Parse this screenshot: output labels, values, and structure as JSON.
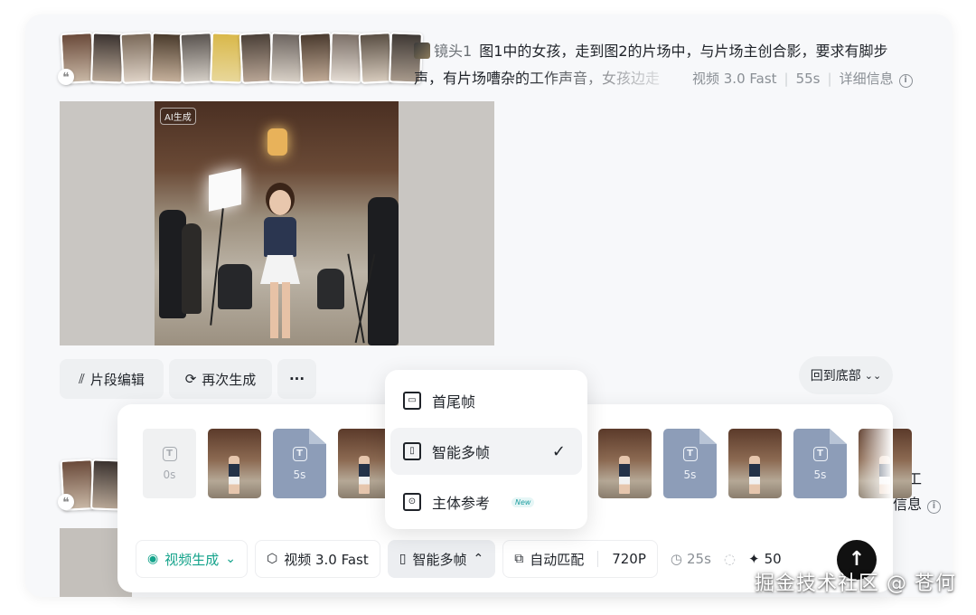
{
  "record1": {
    "shot_label": "镜头1",
    "prompt_line1": "图1中的女孩，走到图2的片场中，与片场主创合影，要求有脚步",
    "prompt_line2": "声，有片场嘈杂的工作声音，女孩边走",
    "model": "视频 3.0 Fast",
    "duration": "55s",
    "details_link": "详细信息",
    "ai_tag": "AI生成",
    "actions": {
      "edit": "片段编辑",
      "regenerate": "再次生成",
      "more": "···"
    }
  },
  "back_to_bottom": "回到底部",
  "record2": {
    "text_tail": "的工",
    "details_tail": "信息"
  },
  "composer": {
    "frames": [
      {
        "kind": "slot",
        "label": "0s"
      },
      {
        "kind": "image"
      },
      {
        "kind": "doc",
        "label": "5s"
      },
      {
        "kind": "image"
      },
      {
        "kind": "image"
      },
      {
        "kind": "image"
      },
      {
        "kind": "image"
      },
      {
        "kind": "image"
      },
      {
        "kind": "doc",
        "label": "5s"
      },
      {
        "kind": "image"
      },
      {
        "kind": "doc",
        "label": "5s"
      },
      {
        "kind": "image"
      }
    ],
    "toolbar": {
      "mode": "视频生成",
      "model": "视频 3.0 Fast",
      "frame_mode": "智能多帧",
      "ratio": "自动匹配",
      "resolution": "720P",
      "duration": "25s",
      "credits": "50"
    }
  },
  "dropdown": {
    "items": [
      {
        "label": "首尾帧",
        "selected": false,
        "badge": ""
      },
      {
        "label": "智能多帧",
        "selected": true,
        "badge": ""
      },
      {
        "label": "主体参考",
        "selected": false,
        "badge": "New"
      }
    ]
  },
  "watermark": "掘金技术社区 @ 苍何",
  "colors": {
    "accent": "#14a38b",
    "send": "#111111",
    "doc_frame": "#8d9db8"
  }
}
